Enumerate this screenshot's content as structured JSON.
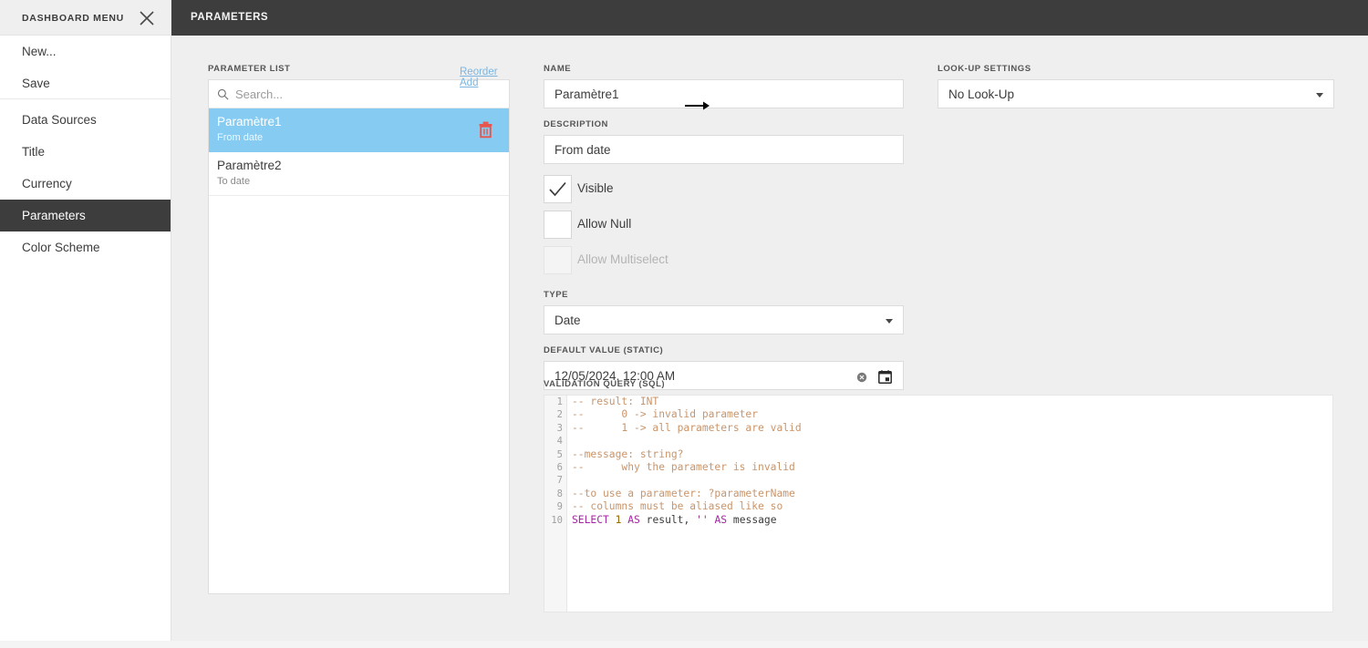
{
  "topbar": {
    "title": "PARAMETERS"
  },
  "menu": {
    "header_title": "DASHBOARD MENU",
    "close_icon": "close-icon",
    "items": [
      {
        "label": "New...",
        "active": false
      },
      {
        "label": "Save",
        "active": false
      },
      {
        "label": "Data Sources",
        "active": false
      },
      {
        "label": "Title",
        "active": false
      },
      {
        "label": "Currency",
        "active": false
      },
      {
        "label": "Parameters",
        "active": true
      },
      {
        "label": "Color Scheme",
        "active": false
      }
    ]
  },
  "parameter_list": {
    "label": "PARAMETER LIST",
    "reorder_link": "Reorder",
    "add_link": "Add",
    "search": {
      "placeholder": "Search...",
      "value": "",
      "icon": "search-icon"
    },
    "delete_icon": "trash-icon",
    "items": [
      {
        "name": "Paramètre1",
        "description": "From date",
        "selected": true
      },
      {
        "name": "Paramètre2",
        "description": "To date",
        "selected": false
      }
    ]
  },
  "form": {
    "name": {
      "label": "NAME",
      "value": "Paramètre1"
    },
    "description": {
      "label": "DESCRIPTION",
      "value": "From date"
    },
    "visible": {
      "label": "Visible",
      "checked": true,
      "disabled": false
    },
    "allow_null": {
      "label": "Allow Null",
      "checked": false,
      "disabled": false
    },
    "allow_multiselect": {
      "label": "Allow Multiselect",
      "checked": false,
      "disabled": true
    },
    "type": {
      "label": "TYPE",
      "value": "Date"
    },
    "default_value": {
      "label": "DEFAULT VALUE (STATIC)",
      "value": "12/05/2024, 12:00 AM",
      "clear_icon": "clear-circle-icon",
      "calendar_icon": "calendar-icon"
    },
    "validation_query": {
      "label": "VALIDATION QUERY (SQL)",
      "line_numbers": [
        "1",
        "2",
        "3",
        "4",
        "5",
        "6",
        "7",
        "8",
        "9",
        "10"
      ],
      "lines": [
        [
          {
            "t": "-- result: INT",
            "c": "comment"
          }
        ],
        [
          {
            "t": "--      0 -> invalid parameter",
            "c": "comment"
          }
        ],
        [
          {
            "t": "--      1 -> all parameters are valid",
            "c": "comment"
          }
        ],
        [
          {
            "t": "",
            "c": "plain"
          }
        ],
        [
          {
            "t": "--message: string?",
            "c": "comment"
          }
        ],
        [
          {
            "t": "--      why the parameter is invalid",
            "c": "comment"
          }
        ],
        [
          {
            "t": "",
            "c": "plain"
          }
        ],
        [
          {
            "t": "--to use a parameter: ?parameterName",
            "c": "comment"
          }
        ],
        [
          {
            "t": "-- columns must be aliased like so",
            "c": "comment"
          }
        ],
        [
          {
            "t": "SELECT",
            "c": "keyword"
          },
          {
            "t": " ",
            "c": "plain"
          },
          {
            "t": "1",
            "c": "number"
          },
          {
            "t": " ",
            "c": "plain"
          },
          {
            "t": "AS",
            "c": "keyword"
          },
          {
            "t": " result, ",
            "c": "plain"
          },
          {
            "t": "''",
            "c": "string"
          },
          {
            "t": " ",
            "c": "plain"
          },
          {
            "t": "AS",
            "c": "keyword"
          },
          {
            "t": " message",
            "c": "plain"
          }
        ]
      ]
    }
  },
  "lookup": {
    "label": "LOOK-UP SETTINGS",
    "value": "No Look-Up"
  },
  "annotation": {
    "arrow": "arrow-right-annotation"
  },
  "colors": {
    "topbar": "#3d3d3d",
    "selection": "#86ccf2",
    "link": "#7cb5e0",
    "delete": "#e8554d",
    "page_bg": "#efefef"
  }
}
